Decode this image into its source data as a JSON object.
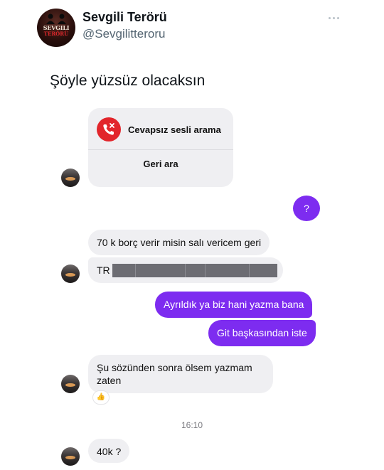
{
  "tweet": {
    "display_name": "Sevgili Terörü",
    "handle": "@Sevgilitteroru",
    "avatar_logo_top": "SEVGILI",
    "avatar_logo_bottom": "TERÖRÜ",
    "text": "Şöyle yüzsüz olacaksın"
  },
  "chat": {
    "missed_call": {
      "title": "Cevapsız sesli arama",
      "action": "Geri ara",
      "icon": "missed-call-icon",
      "icon_color": "#e2252b"
    },
    "messages": [
      {
        "from": "me",
        "text": "?"
      },
      {
        "from": "them",
        "text": "70 k borç verir misin salı vericem geri"
      },
      {
        "from": "them",
        "text": "TR"
      },
      {
        "from": "me",
        "text": "Ayrıldık ya biz hani yazma bana"
      },
      {
        "from": "me",
        "text": "Git başkasından iste"
      },
      {
        "from": "them",
        "text": "Şu sözünden sonra ölsem yazmam zaten",
        "reaction": "👍"
      },
      {
        "from": "them",
        "text": "40k ?"
      }
    ],
    "timestamp": "16:10"
  },
  "colors": {
    "outgoing_bubble": "#7d2cf0",
    "incoming_bubble": "#efeff2",
    "handle_gray": "#536471"
  }
}
